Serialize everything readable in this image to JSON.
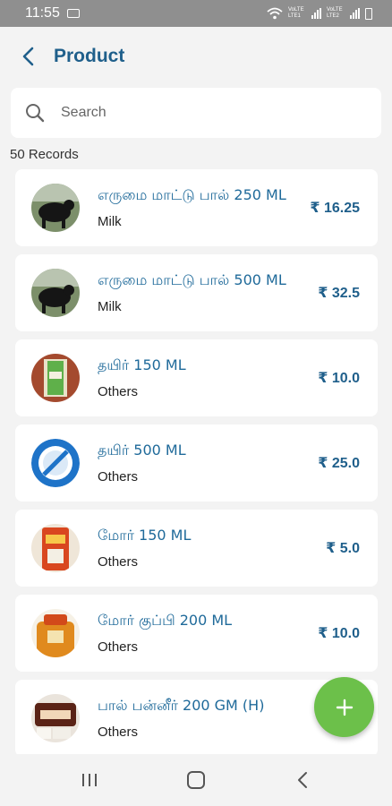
{
  "status": {
    "time": "11:55",
    "net1": "VoLTE LTE1",
    "net2": "VoLTE LTE2"
  },
  "header": {
    "title": "Product"
  },
  "search": {
    "placeholder": "Search"
  },
  "records": "50 Records",
  "currency": "₹",
  "products": [
    {
      "name": "எருமை மாட்டு பால் 250 ML",
      "category": "Milk",
      "price": "₹ 16.25",
      "thumb": "buffalo"
    },
    {
      "name": "எருமை மாட்டு பால் 500 ML",
      "category": "Milk",
      "price": "₹ 32.5",
      "thumb": "buffalo"
    },
    {
      "name": "தயிர் 150 ML",
      "category": "Others",
      "price": "₹ 10.0",
      "thumb": "curd-cup"
    },
    {
      "name": "தயிர் 500 ML",
      "category": "Others",
      "price": "₹ 25.0",
      "thumb": "no-image"
    },
    {
      "name": "மோர் 150 ML",
      "category": "Others",
      "price": "₹ 5.0",
      "thumb": "buttermilk"
    },
    {
      "name": "மோர் குப்பி 200 ML",
      "category": "Others",
      "price": "₹ 10.0",
      "thumb": "bottle"
    },
    {
      "name": "பால் பன்னீர் 200 GM (H)",
      "category": "Others",
      "price": "",
      "thumb": "paneer"
    }
  ],
  "colors": {
    "accent": "#1f5f8b",
    "fab": "#6cc04a",
    "status_bar": "#8f8f8f"
  }
}
